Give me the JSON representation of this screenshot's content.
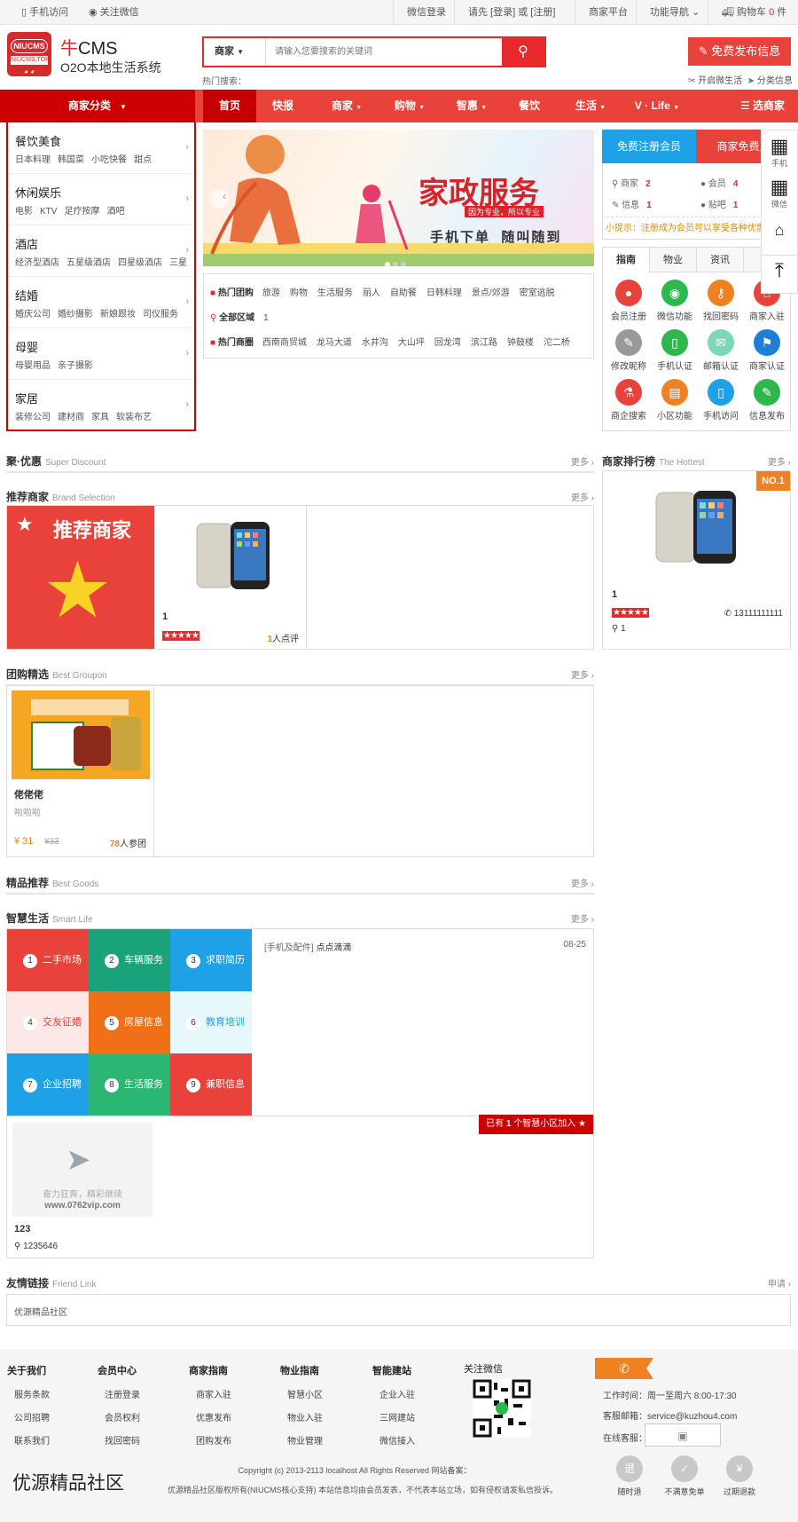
{
  "topbar": {
    "mobile": "手机访问",
    "wechat_follow": "关注微信",
    "wechat_login": "微信登录",
    "login_prompt_pre": "请先 [",
    "login": "登录",
    "login_mid": "] 或 [",
    "register": "注册",
    "login_prompt_post": "]",
    "merchant_platform": "商家平台",
    "function_nav": "功能导航",
    "cart": "购物车",
    "cart_count": "0",
    "cart_unit": "件"
  },
  "header": {
    "logo_text_top": "NIUCMS",
    "logo_text_bottom": "NIUCMS.TOP",
    "brand_red": "牛",
    "brand": "CMS",
    "slogan": "O2O本地生活系统",
    "search_type": "商家",
    "search_placeholder": "请输入您要搜索的关键词",
    "hot_search_label": "热门搜索：",
    "free_post": "免费发布信息",
    "open_wechat": "开启微生活",
    "category_info": "分类信息"
  },
  "nav": {
    "category": "商家分类",
    "items": [
      "首页",
      "快报",
      "商家",
      "购物",
      "智惠",
      "餐饮",
      "生活",
      "V · Life"
    ],
    "choose_merchant": "选商家"
  },
  "categories": [
    {
      "title": "餐饮美食",
      "subs": [
        "日本料理",
        "韩国菜",
        "小吃快餐",
        "甜点"
      ]
    },
    {
      "title": "休闲娱乐",
      "subs": [
        "电影",
        "KTV",
        "足疗按摩",
        "酒吧"
      ]
    },
    {
      "title": "酒店",
      "subs": [
        "经济型酒店",
        "五星级酒店",
        "四星级酒店",
        "三星"
      ]
    },
    {
      "title": "结婚",
      "subs": [
        "婚庆公司",
        "婚纱摄影",
        "新娘跟妆",
        "司仪服务"
      ]
    },
    {
      "title": "母婴",
      "subs": [
        "母婴用品",
        "亲子摄影"
      ]
    },
    {
      "title": "家居",
      "subs": [
        "装修公司",
        "建材商",
        "家具",
        "软装布艺"
      ]
    }
  ],
  "banner": {
    "title": "家政服务",
    "sub": "因为专业，所以专业",
    "slogan": "手机下单  随叫随到"
  },
  "hot": {
    "groupon_label": "热门团购",
    "groupon": [
      "旅游",
      "购物",
      "生活服务",
      "丽人",
      "自助餐",
      "日韩料理",
      "景点/郊游",
      "密室逃脱"
    ],
    "area_label": "全部区域",
    "area_count": "1",
    "district_label": "热门商圈",
    "districts": [
      "西南商贸城",
      "龙马大道",
      "水井沟",
      "大山坪",
      "回龙湾",
      "滨江路",
      "钟鼓楼",
      "沱二桥"
    ]
  },
  "member": {
    "reg": "免费注册会员",
    "merchant": "商家免费入",
    "stats": [
      {
        "label": "商家",
        "value": "2"
      },
      {
        "label": "会员",
        "value": "4"
      },
      {
        "label": "信息",
        "value": "1"
      },
      {
        "label": "贴吧",
        "value": "1"
      }
    ],
    "tip": "小提示：注册成为会员可以享受各种优惠"
  },
  "guide": {
    "tabs": [
      "指南",
      "物业",
      "资讯",
      "商"
    ],
    "items": [
      {
        "label": "会员注册",
        "color": "#e8423b",
        "icon": "user-icon",
        "glyph": "●"
      },
      {
        "label": "微信功能",
        "color": "#2db84d",
        "icon": "wechat-icon",
        "glyph": "◉"
      },
      {
        "label": "找回密码",
        "color": "#f08121",
        "icon": "key-icon",
        "glyph": "⚷"
      },
      {
        "label": "商家入驻",
        "color": "#e8423b",
        "icon": "home-icon",
        "glyph": "⌂"
      },
      {
        "label": "修改昵称",
        "color": "#999999",
        "icon": "pencil-icon",
        "glyph": "✎"
      },
      {
        "label": "手机认证",
        "color": "#2db84d",
        "icon": "phone-icon",
        "glyph": "▯"
      },
      {
        "label": "邮箱认证",
        "color": "#7dd8b5",
        "icon": "mail-icon",
        "glyph": "✉"
      },
      {
        "label": "商家认证",
        "color": "#1e7fd6",
        "icon": "flag-icon",
        "glyph": "⚑"
      },
      {
        "label": "商企搜索",
        "color": "#e8423b",
        "icon": "flask-icon",
        "glyph": "⚗"
      },
      {
        "label": "小区功能",
        "color": "#f08121",
        "icon": "building-icon",
        "glyph": "▤"
      },
      {
        "label": "手机访问",
        "color": "#1ea1e6",
        "icon": "mobile-icon",
        "glyph": "▯"
      },
      {
        "label": "信息发布",
        "color": "#2db84d",
        "icon": "edit-icon",
        "glyph": "✎"
      }
    ]
  },
  "sidefloat": {
    "mobile": "手机",
    "wechat": "微信"
  },
  "sections": {
    "discount": {
      "title": "聚·优惠",
      "en": "Super Discount",
      "more": "更多 ›"
    },
    "brand": {
      "title": "推荐商家",
      "en": "Brand Selection",
      "more": "更多 ›"
    },
    "groupon": {
      "title": "团购精选",
      "en": "Best Groupon",
      "more": "更多 ›"
    },
    "goods": {
      "title": "精品推荐",
      "en": "Best Goods",
      "more": "更多 ›"
    },
    "smart": {
      "title": "智慧生活",
      "en": "Smart Life",
      "more": "更多 ›"
    },
    "hottest": {
      "title": "商家排行榜",
      "en": "The Hottest",
      "more": "更多 ›"
    },
    "friend": {
      "title": "友情链接",
      "en": "Friend Link",
      "more": "申请 ›"
    }
  },
  "brand": {
    "banner_text": "推荐商家",
    "item_name": "1",
    "reviews_count": "1",
    "reviews_unit": "人点评"
  },
  "hottest": {
    "badge": "NO.1",
    "name": "1",
    "phone": "13111111111",
    "location": "1"
  },
  "groupon_item": {
    "name": "佬佬佬",
    "desc": "啦啦啦",
    "price": "¥ 31",
    "orig_price": "¥33",
    "joined": "78",
    "joined_unit": "人参团"
  },
  "smart": {
    "cells": [
      {
        "n": "1",
        "label": "二手市场",
        "bg": "#e8423b",
        "fg": "#ffffff"
      },
      {
        "n": "2",
        "label": "车辆服务",
        "bg": "#1aa37a",
        "fg": "#ffffff"
      },
      {
        "n": "3",
        "label": "求职简历",
        "bg": "#1ea1e6",
        "fg": "#ffffff"
      },
      {
        "n": "4",
        "label": "交友征婚",
        "bg": "#fde8e8",
        "fg": "#e8423b"
      },
      {
        "n": "5",
        "label": "房屋信息",
        "bg": "#f07018",
        "fg": "#ffffff"
      },
      {
        "n": "6",
        "label": "教育培训",
        "bg": "#e6f8fc",
        "fg": "#1ea1e6"
      },
      {
        "n": "7",
        "label": "企业招聘",
        "bg": "#1ea1e6",
        "fg": "#ffffff"
      },
      {
        "n": "8",
        "label": "生活服务",
        "bg": "#2bb673",
        "fg": "#ffffff"
      },
      {
        "n": "9",
        "label": "兼职信息",
        "bg": "#e8423b",
        "fg": "#ffffff"
      }
    ],
    "news_cat": "[手机及配件]",
    "news_title": "点点滴滴",
    "news_date": "08-25",
    "join_pre": "已有",
    "join_count": "1",
    "join_post": "个智慧小区加入",
    "placeholder_text": "奋力狂奔，精彩继续",
    "placeholder_url": "www.0762vip.com",
    "community_name": "123",
    "community_loc": "1235646"
  },
  "friend_links": [
    "优源精品社区"
  ],
  "footer": {
    "cols": [
      {
        "h": "关于我们",
        "links": [
          "服务条款",
          "公司招聘",
          "联系我们"
        ]
      },
      {
        "h": "会员中心",
        "links": [
          "注册登录",
          "会员权利",
          "找回密码"
        ]
      },
      {
        "h": "商家指南",
        "links": [
          "商家入驻",
          "优惠发布",
          "团购发布"
        ]
      },
      {
        "h": "物业指南",
        "links": [
          "智慧小区",
          "物业入驻",
          "物业管理"
        ]
      },
      {
        "h": "智能建站",
        "links": [
          "企业入驻",
          "三网建站",
          "微信接入"
        ]
      }
    ],
    "follow_wechat": "关注微信",
    "work_time": "工作时间：周一至周六 8:00-17:30",
    "email": "客服邮箱：service@kuzhou4.com",
    "online_service": "在线客服：",
    "site_name": "优源精品社区",
    "copyright": "Copyright (c) 2013-2113 localhost All Rights Reserved 网站备案：",
    "disclaimer": "优源精品社区版权所有(NIUCMS核心支持) 本站信息均由会员发表，不代表本站立场，如有侵权请发私信投诉。",
    "badges": [
      {
        "icon": "退",
        "label": "随时退"
      },
      {
        "icon": "✓",
        "label": "不满意免单"
      },
      {
        "icon": "¥",
        "label": "过期退款"
      }
    ]
  }
}
